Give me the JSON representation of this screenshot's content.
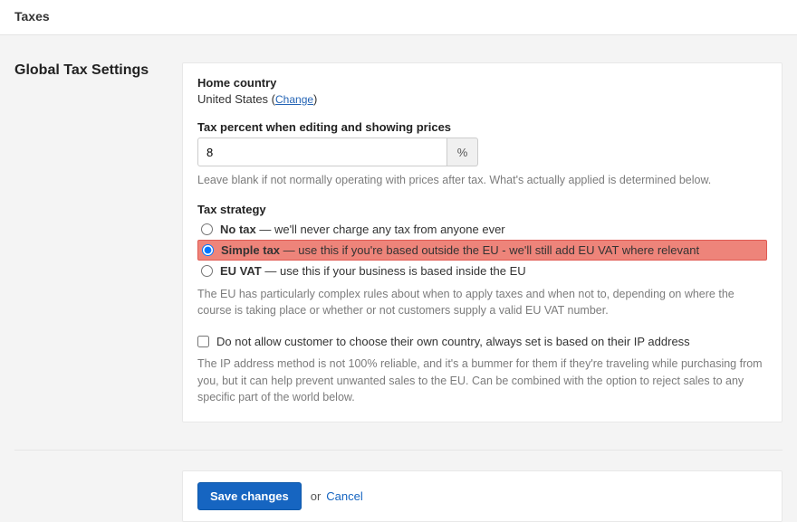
{
  "header": {
    "title": "Taxes"
  },
  "section": {
    "title": "Global Tax Settings"
  },
  "home_country": {
    "label": "Home country",
    "value": "United States",
    "change_text": "Change"
  },
  "tax_percent": {
    "label": "Tax percent when editing and showing prices",
    "value": "8",
    "unit": "%",
    "help": "Leave blank if not normally operating with prices after tax. What's actually applied is determined below."
  },
  "tax_strategy": {
    "label": "Tax strategy",
    "options": [
      {
        "name": "No tax",
        "desc": "we'll never charge any tax from anyone ever",
        "selected": false,
        "highlight": false
      },
      {
        "name": "Simple tax",
        "desc": "use this if you're based outside the EU - we'll still add EU VAT where relevant",
        "selected": true,
        "highlight": true
      },
      {
        "name": "EU VAT",
        "desc": "use this if your business is based inside the EU",
        "selected": false,
        "highlight": false
      }
    ],
    "help": "The EU has particularly complex rules about when to apply taxes and when not to, depending on where the course is taking place or whether or not customers supply a valid EU VAT number."
  },
  "ip_lock": {
    "label": "Do not allow customer to choose their own country, always set is based on their IP address",
    "checked": false,
    "help": "The IP address method is not 100% reliable, and it's a bummer for them if they're traveling while purchasing from you, but it can help prevent unwanted sales to the EU. Can be combined with the option to reject sales to any specific part of the world below."
  },
  "actions": {
    "save": "Save changes",
    "or": "or",
    "cancel": "Cancel"
  }
}
